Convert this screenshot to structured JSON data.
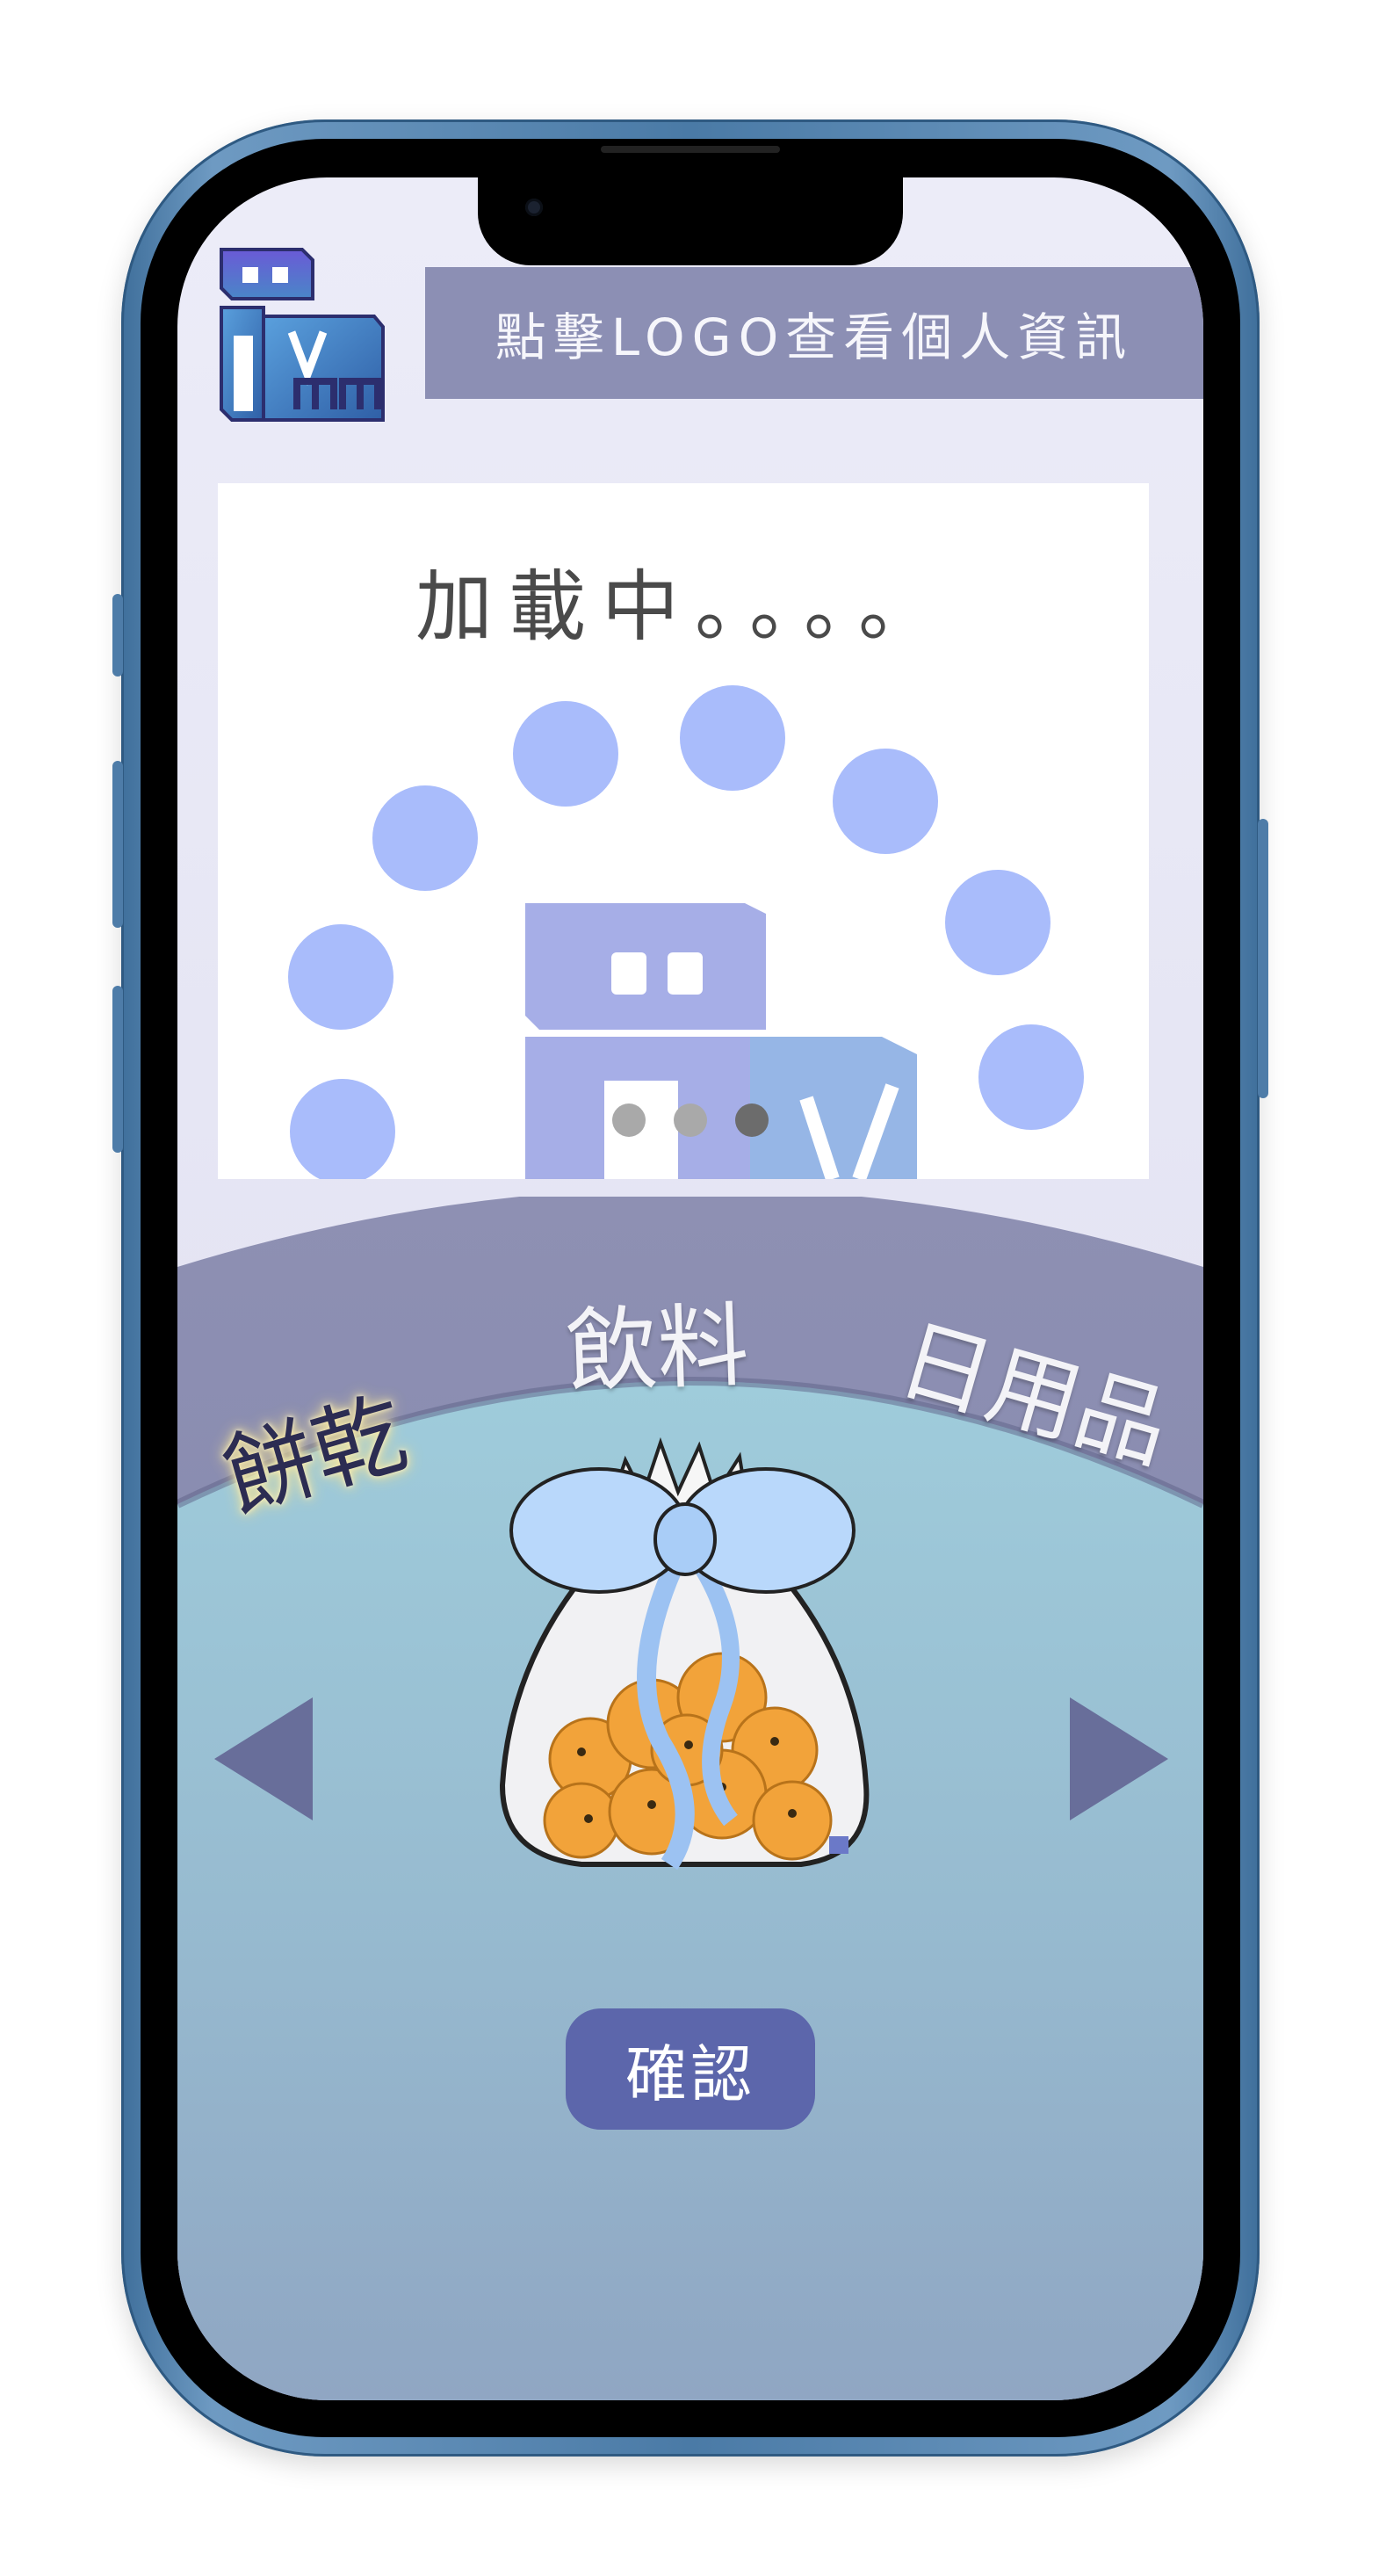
{
  "header": {
    "info_text": "點擊LOGO查看個人資訊",
    "logo_text": "IVm"
  },
  "banner": {
    "loading_text": "加載中。。。。",
    "page_count": 3,
    "active_page": 3
  },
  "categories": [
    {
      "label": "餅乾",
      "selected": true
    },
    {
      "label": "飲料",
      "selected": false
    },
    {
      "label": "日用品",
      "selected": false
    }
  ],
  "product": {
    "icon": "cookie-bag-icon"
  },
  "actions": {
    "confirm_label": "確認"
  },
  "colors": {
    "header_bar": "#8c8fb4",
    "arc": "#8a8db0",
    "teal_top": "#9dcbd9",
    "teal_bottom": "#8fa8c3",
    "button": "#5c66ab",
    "loading_dot": "#a9bcfb",
    "arrow": "#686e9a"
  }
}
